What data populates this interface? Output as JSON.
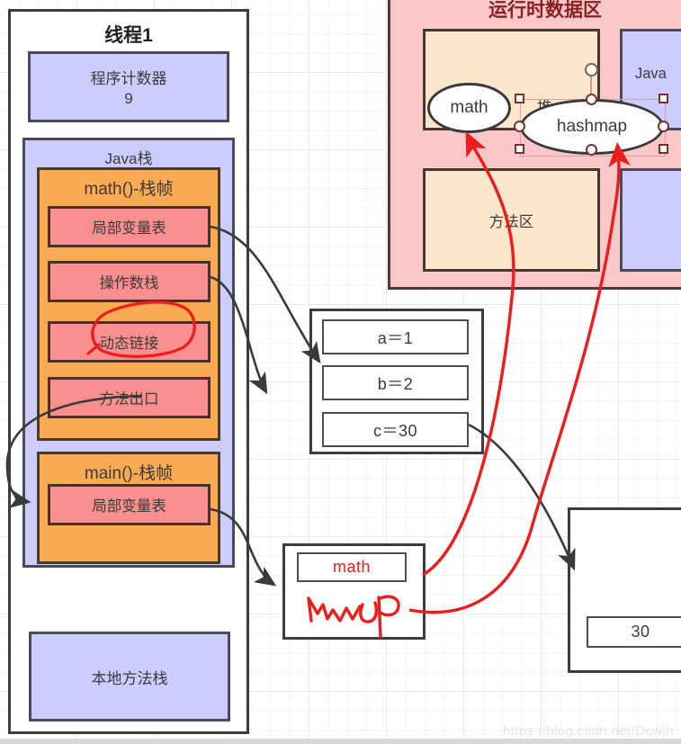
{
  "diagram": {
    "title_watermark": "https://blog.csdn.net/Dcwjh",
    "thread_panel": {
      "title": "线程1",
      "program_counter": {
        "label": "程序计数器",
        "value": "9"
      },
      "java_stack": {
        "label": "Java栈",
        "frames": [
          {
            "label": "math()-栈帧",
            "slots": [
              "局部变量表",
              "操作数栈",
              "动态链接",
              "方法出口"
            ]
          },
          {
            "label": "main()-栈帧",
            "slots": [
              "局部变量表"
            ]
          }
        ]
      },
      "native_stack": {
        "label": "本地方法栈"
      }
    },
    "runtime_area": {
      "title": "运行时数据区",
      "heap": {
        "label": "堆",
        "objects": [
          {
            "label": "math"
          },
          {
            "label": "hashmap"
          }
        ]
      },
      "method_area": {
        "label": "方法区"
      },
      "right_top": {
        "label": "Java"
      },
      "right_bottom": {
        "label": ""
      }
    },
    "local_var_table": {
      "rows": [
        "a＝1",
        "b＝2",
        "c＝30"
      ]
    },
    "object_ref_box": {
      "rows": [
        "math"
      ],
      "annotation": "map"
    },
    "value_box": {
      "rows": [
        "30"
      ]
    },
    "colors": {
      "purple": "#ccccff",
      "orange": "#f9aa53",
      "pink": "#fa8f8f",
      "outer_pink": "#fac8c8",
      "peach": "#fce7cd",
      "red_annotation": "#ee1c1c",
      "stroke": "#3d3d3d"
    }
  }
}
